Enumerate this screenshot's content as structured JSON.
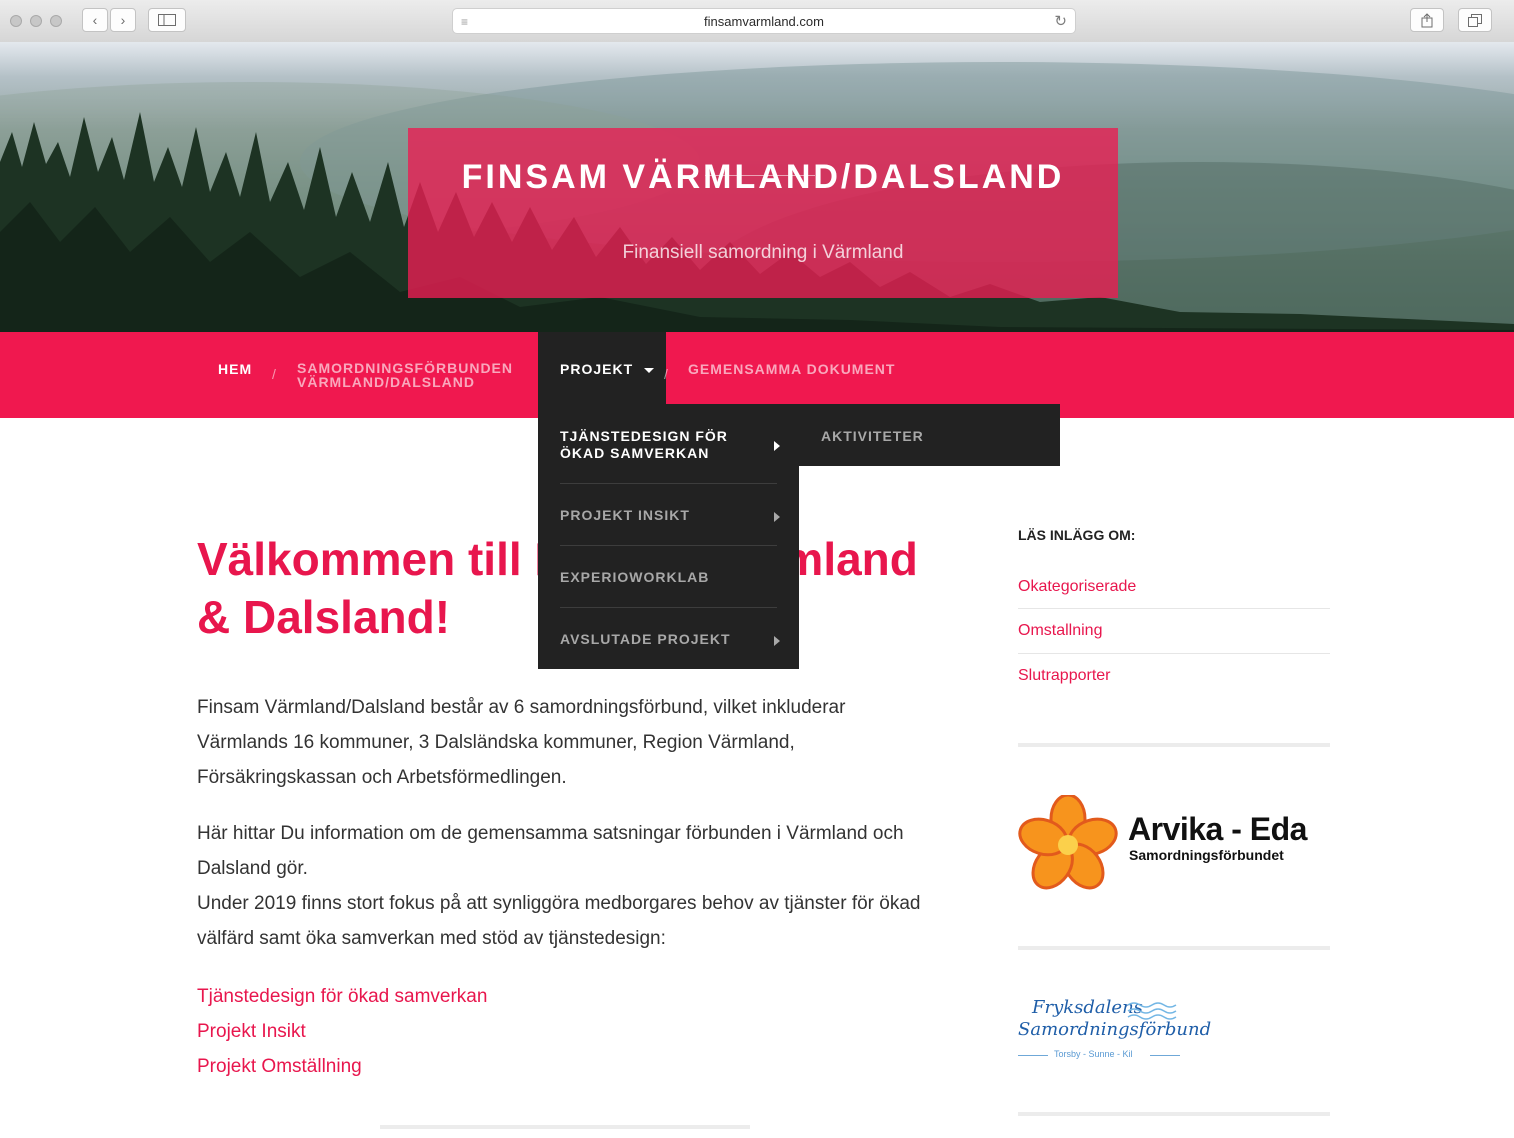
{
  "browser": {
    "url": "finsamvarmland.com",
    "back_glyph": "‹",
    "forward_glyph": "›",
    "reload_glyph": "↻",
    "menu_glyph": "≡"
  },
  "site": {
    "title": "FINSAM VÄRMLAND/DALSLAND",
    "tagline": "Finansiell samordning i Värmland"
  },
  "nav": {
    "items": [
      {
        "label": "HEM"
      },
      {
        "label_line1": "SAMORDNINGSFÖRBUNDEN",
        "label_line2": "VÄRMLAND/DALSLAND"
      },
      {
        "label": "PROJEKT"
      },
      {
        "label": "GEMENSAMMA DOKUMENT"
      }
    ],
    "separator": "/"
  },
  "dropdown": {
    "items": [
      {
        "line1": "TJÄNSTEDESIGN FÖR",
        "line2": "ÖKAD SAMVERKAN"
      },
      {
        "label": "PROJEKT INSIKT"
      },
      {
        "label": "EXPERIOWORKLAB"
      },
      {
        "label": "AVSLUTADE PROJEKT"
      }
    ],
    "submenu": {
      "label": "AKTIVITETER"
    }
  },
  "main": {
    "heading_line1": "Välkommen till Finsam Värmland",
    "heading_line2": "& Dalsland!",
    "para1": "Finsam Värmland/Dalsland består av 6 samordningsförbund, vilket inkluderar Värmlands 16 kommuner, 3 Dalsländska kommuner, Region Värmland, Försäkringskassan och Arbetsförmedlingen.",
    "para2": "Här hittar Du information om de gemensamma satsningar förbunden i Värmland och Dalsland gör.",
    "para3": "Under 2019 finns stort fokus på att synliggöra medborgares behov av tjänster för ökad välfärd samt öka samverkan med stöd av tjänstedesign:",
    "links": [
      "Tjänstedesign för ökad samverkan",
      "Projekt Insikt",
      "Projekt Omställning"
    ]
  },
  "sidebar": {
    "title": "LÄS INLÄGG OM:",
    "categories": [
      "Okategoriserade",
      "Omstallning",
      "Slutrapporter"
    ],
    "logo1": {
      "name": "Arvika - Eda",
      "sub": "Samordningsförbundet"
    },
    "logo2": {
      "line1": "Fryksdalens",
      "line2": "Samordningsförbund",
      "line3": "Torsby - Sunne - Kil"
    }
  },
  "colors": {
    "accent": "#f0184f",
    "dropdown_bg": "#222222",
    "text": "#333333"
  }
}
